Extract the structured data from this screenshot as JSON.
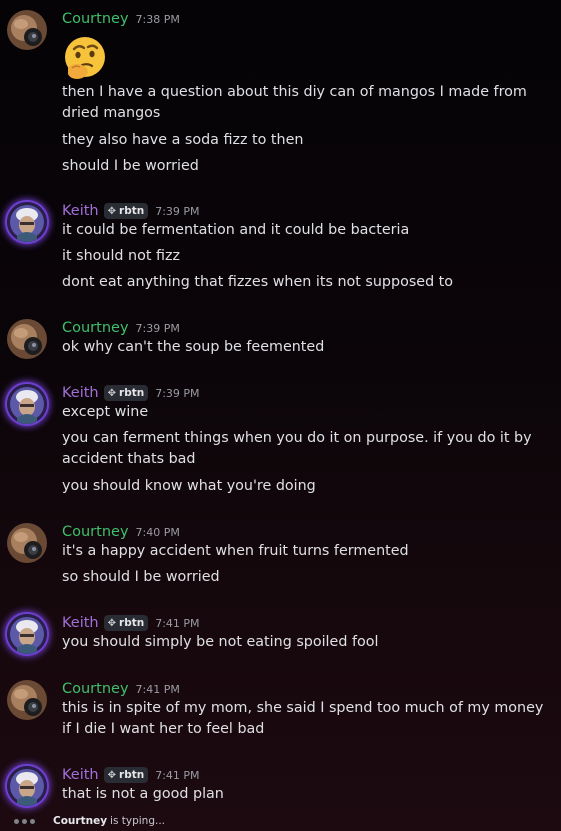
{
  "users": {
    "courtney": {
      "name": "Courtney",
      "color": "#3fbf6b"
    },
    "keith": {
      "name": "Keith",
      "color": "#a36fd9",
      "tag": "rbtn",
      "tag_icon": "sparkle-icon"
    }
  },
  "messages": [
    {
      "author": "Courtney",
      "time": "7:38 PM",
      "emoji": "thinking-face-emoji",
      "lines": [
        "then I have a question about this diy can of mangos I made from dried mangos",
        "they also have a soda fizz to then",
        "should I be worried"
      ]
    },
    {
      "author": "Keith",
      "time": "7:39 PM",
      "lines": [
        "it could be fermentation and it could be bacteria",
        "it should not fizz",
        "dont eat anything that fizzes when its not supposed to"
      ]
    },
    {
      "author": "Courtney",
      "time": "7:39 PM",
      "lines": [
        "ok why can't the soup be feemented"
      ]
    },
    {
      "author": "Keith",
      "time": "7:39 PM",
      "lines": [
        "except wine",
        "you can ferment things when you do it on purpose. if you do it by accident thats bad",
        "you should know what you're doing"
      ]
    },
    {
      "author": "Courtney",
      "time": "7:40 PM",
      "lines": [
        "it's a happy accident when fruit turns fermented",
        "so should I be worried"
      ]
    },
    {
      "author": "Keith",
      "time": "7:41 PM",
      "lines": [
        "you should simply be not eating spoiled fool"
      ]
    },
    {
      "author": "Courtney",
      "time": "7:41 PM",
      "lines": [
        "this is in spite of my mom, she said I spend too much of my money if I die I want her to feel bad"
      ]
    },
    {
      "author": "Keith",
      "time": "7:41 PM",
      "lines": [
        "that is not a good plan"
      ]
    }
  ],
  "typing": {
    "user": "Courtney",
    "text": "is typing..."
  }
}
